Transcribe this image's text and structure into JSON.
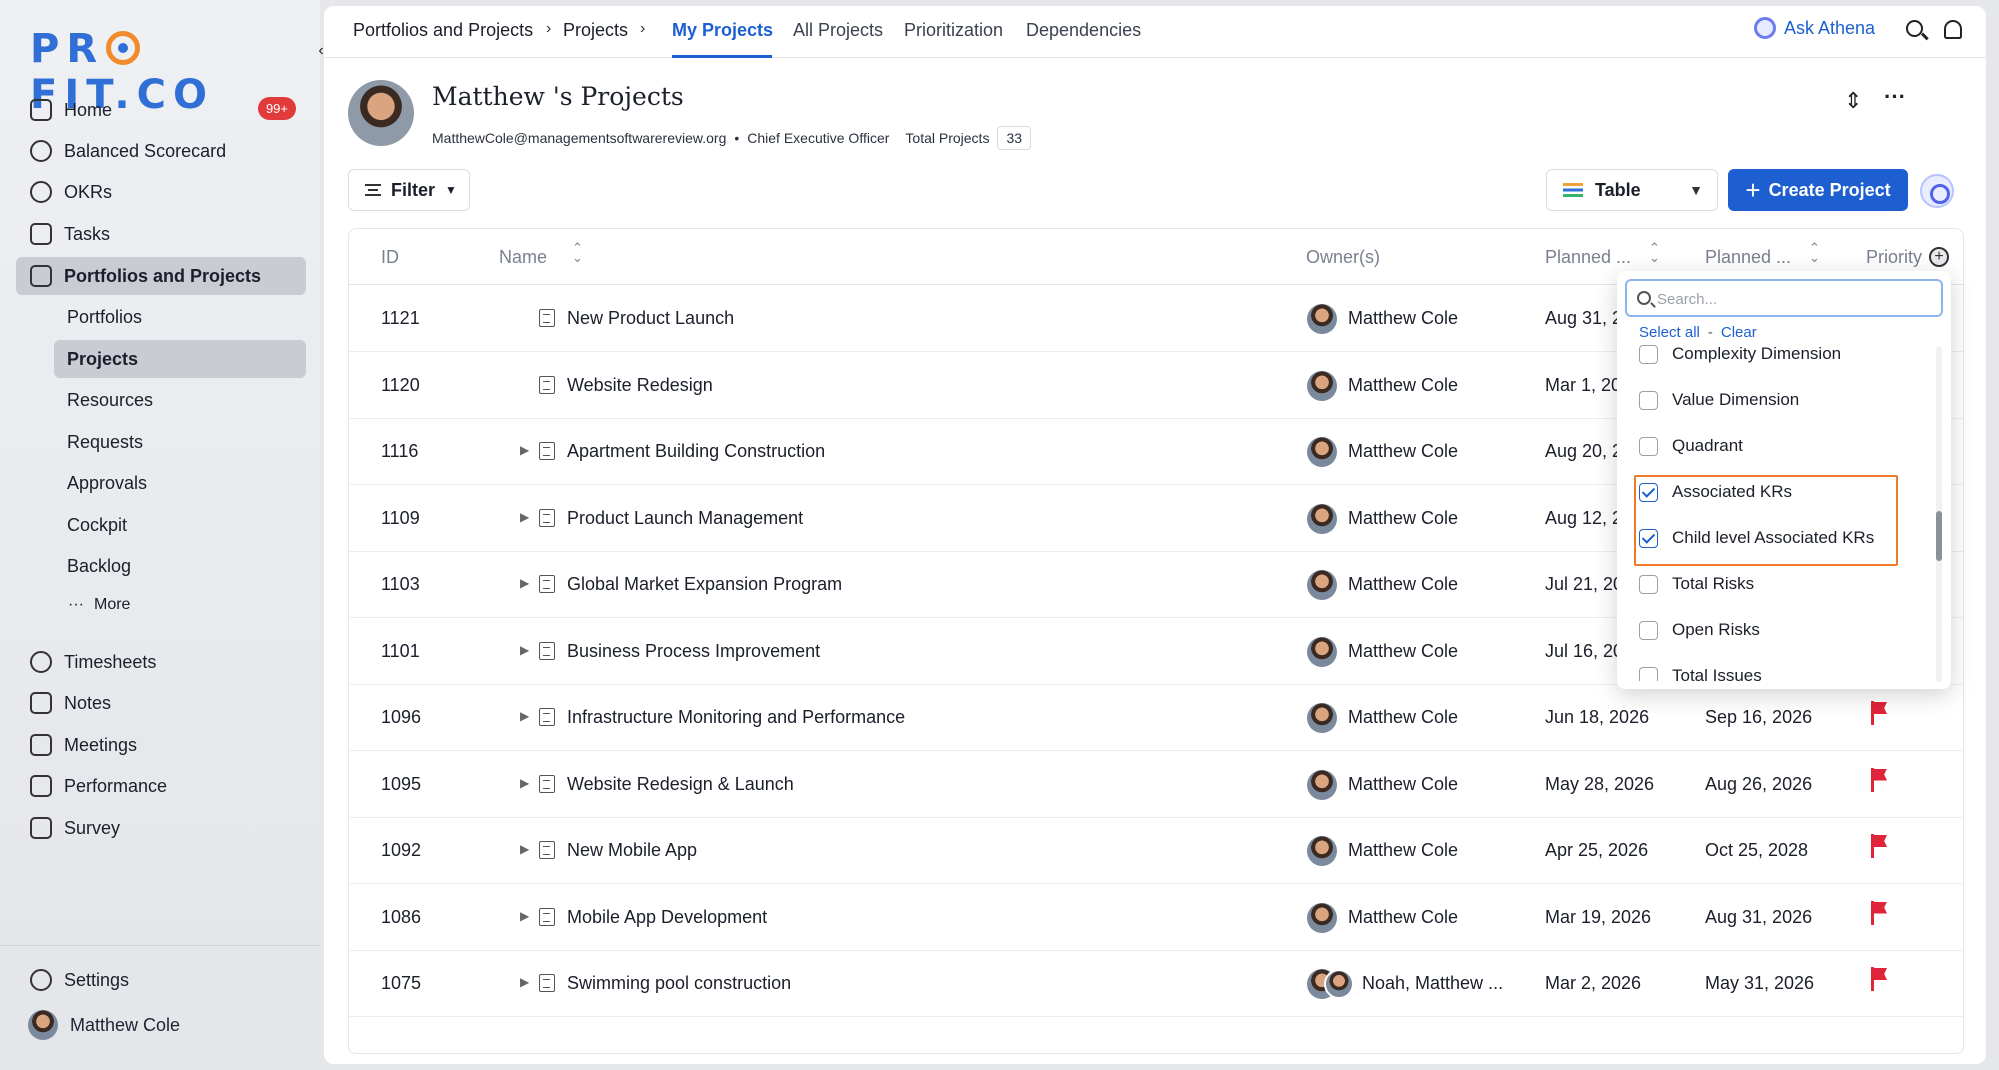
{
  "brand": {
    "logo_pre": "PR",
    "logo_post": "FIT.CO"
  },
  "sidebar": {
    "collapse_icon": "‹",
    "items": [
      {
        "label": "Home",
        "icon": "home-icon",
        "badge": "99+"
      },
      {
        "label": "Balanced Scorecard",
        "icon": "scorecard-icon"
      },
      {
        "label": "OKRs",
        "icon": "target-icon"
      },
      {
        "label": "Tasks",
        "icon": "tasks-icon"
      },
      {
        "label": "Portfolios and Projects",
        "icon": "briefcase-icon",
        "active": true
      }
    ],
    "sub_items": [
      "Portfolios",
      "Projects",
      "Resources",
      "Requests",
      "Approvals",
      "Cockpit",
      "Backlog"
    ],
    "more_label": "More",
    "more_icon": "···",
    "items2": [
      {
        "label": "Timesheets",
        "icon": "timer-icon"
      },
      {
        "label": "Notes",
        "icon": "notes-icon"
      },
      {
        "label": "Meetings",
        "icon": "calendar-icon"
      },
      {
        "label": "Performance",
        "icon": "performance-icon"
      },
      {
        "label": "Survey",
        "icon": "survey-icon"
      }
    ],
    "settings_label": "Settings",
    "user_name": "Matthew Cole"
  },
  "topbar": {
    "crumbs": [
      "Portfolios and Projects",
      "Projects"
    ],
    "crumb_sep": "›",
    "tabs": [
      "My Projects",
      "All Projects",
      "Prioritization",
      "Dependencies"
    ],
    "ask_athena": "Ask Athena"
  },
  "profile": {
    "name": "Matthew 's Projects",
    "email": "MatthewCole@managementsoftwarereview.org",
    "dot": "•",
    "role": "Chief Executive Officer",
    "total_label": "Total Projects",
    "total_count": "33"
  },
  "toolbar": {
    "filter_label": "Filter",
    "view_label": "Table",
    "create_label": "Create Project",
    "create_plus": "+"
  },
  "table": {
    "columns": [
      "ID",
      "Name",
      "Owner(s)",
      "Planned ...",
      "Planned ...",
      "Priority"
    ],
    "rows": [
      {
        "id": "1121",
        "name": "New Product Launch",
        "owner": "Matthew Cole",
        "start": "Aug 31, 2",
        "end": "",
        "expand": false,
        "flag": false
      },
      {
        "id": "1120",
        "name": "Website Redesign",
        "owner": "Matthew Cole",
        "start": "Mar 1, 20",
        "end": "",
        "expand": false,
        "flag": false
      },
      {
        "id": "1116",
        "name": "Apartment Building Construction",
        "owner": "Matthew Cole",
        "start": "Aug 20, 2",
        "end": "",
        "expand": true,
        "flag": false
      },
      {
        "id": "1109",
        "name": "Product Launch Management",
        "owner": "Matthew Cole",
        "start": "Aug 12, 2",
        "end": "",
        "expand": true,
        "flag": false
      },
      {
        "id": "1103",
        "name": "Global Market Expansion Program",
        "owner": "Matthew Cole",
        "start": "Jul 21, 20",
        "end": "",
        "expand": true,
        "flag": false
      },
      {
        "id": "1101",
        "name": "Business Process Improvement",
        "owner": "Matthew Cole",
        "start": "Jul 16, 20",
        "end": "",
        "expand": true,
        "flag": false
      },
      {
        "id": "1096",
        "name": "Infrastructure Monitoring and Performance",
        "owner": "Matthew Cole",
        "start": "Jun 18, 2026",
        "end": "Sep 16, 2026",
        "expand": true,
        "flag": true
      },
      {
        "id": "1095",
        "name": "Website Redesign & Launch",
        "owner": "Matthew Cole",
        "start": "May 28, 2026",
        "end": "Aug 26, 2026",
        "expand": true,
        "flag": true
      },
      {
        "id": "1092",
        "name": "New Mobile App",
        "owner": "Matthew Cole",
        "start": "Apr 25, 2026",
        "end": "Oct 25, 2028",
        "expand": true,
        "flag": true
      },
      {
        "id": "1086",
        "name": "Mobile App Development",
        "owner": "Matthew Cole",
        "start": "Mar 19, 2026",
        "end": "Aug 31, 2026",
        "expand": true,
        "flag": true
      },
      {
        "id": "1075",
        "name": "Swimming pool construction",
        "owner": "Noah, Matthew ...",
        "start": "Mar 2, 2026",
        "end": "May 31, 2026",
        "expand": true,
        "flag": true,
        "multi": true
      }
    ]
  },
  "column_picker": {
    "search_placeholder": "Search...",
    "select_all": "Select all",
    "dash": "-",
    "clear": "Clear",
    "options": [
      {
        "label": "Complexity Dimension",
        "checked": false
      },
      {
        "label": "Value Dimension",
        "checked": false
      },
      {
        "label": "Quadrant",
        "checked": false
      },
      {
        "label": "Associated KRs",
        "checked": true
      },
      {
        "label": "Child level Associated KRs",
        "checked": true
      },
      {
        "label": "Total Risks",
        "checked": false
      },
      {
        "label": "Open Risks",
        "checked": false
      },
      {
        "label": "Total Issues",
        "checked": false
      }
    ]
  },
  "colors": {
    "accent": "#1d5fd1",
    "highlight": "#f07a2a",
    "badge": "#e23a3a",
    "flag": "#e0243a"
  }
}
